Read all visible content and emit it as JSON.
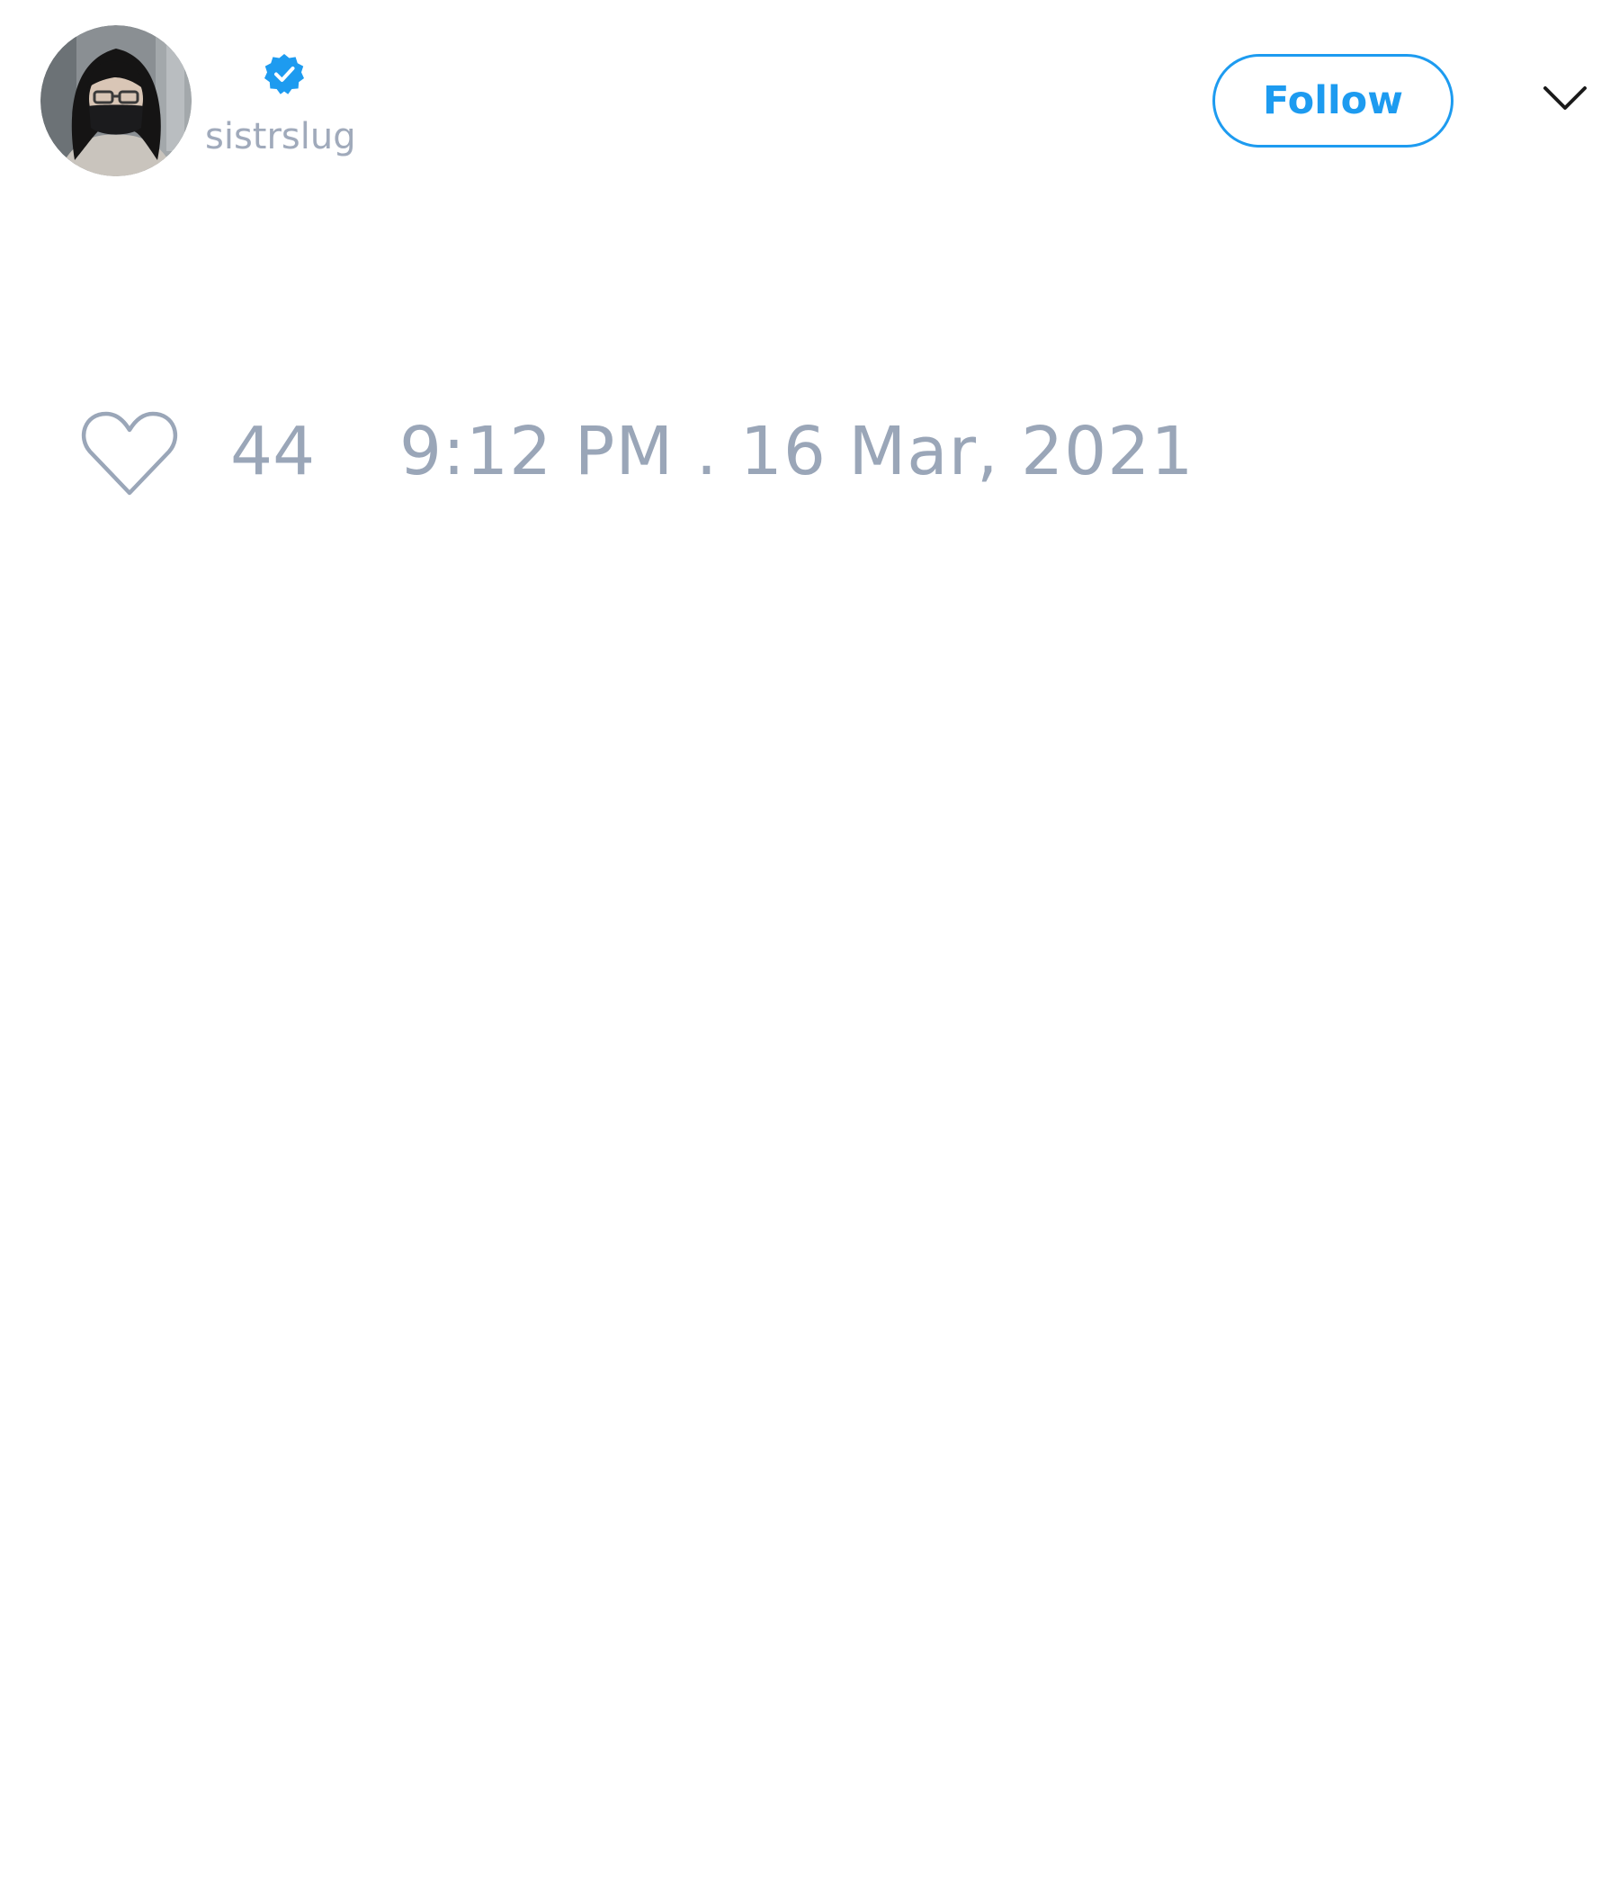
{
  "author": {
    "handle": "sistrslug",
    "verified": true,
    "avatar_icon": "avatar-photo"
  },
  "actions": {
    "follow_label": "Follow",
    "more_icon": "chevron-down-icon"
  },
  "engagement": {
    "like_icon": "heart-icon",
    "like_count": "44"
  },
  "meta": {
    "timestamp": "9:12 PM . 16 Mar, 2021"
  },
  "colors": {
    "accent": "#1d9bf0",
    "muted_text": "#9aa6b8",
    "background": "#ffffff"
  }
}
